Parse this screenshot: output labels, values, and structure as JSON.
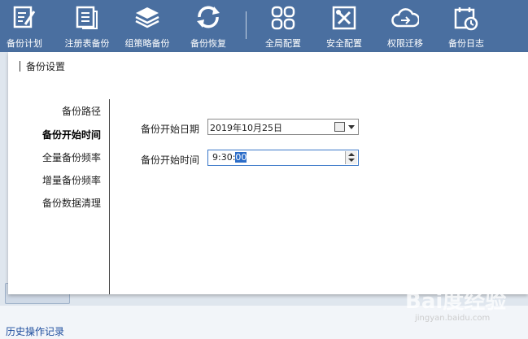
{
  "toolbar": {
    "items": [
      {
        "label": "备份计划",
        "icon": "edit-list-icon"
      },
      {
        "label": "注册表备份",
        "icon": "document-list-icon"
      },
      {
        "label": "组策略备份",
        "icon": "layers-icon"
      },
      {
        "label": "备份恢复",
        "icon": "refresh-icon"
      },
      {
        "label": "全局配置",
        "icon": "grid-icon"
      },
      {
        "label": "安全配置",
        "icon": "tools-icon"
      },
      {
        "label": "权限迁移",
        "icon": "cloud-transfer-icon"
      },
      {
        "label": "备份日志",
        "icon": "calendar-clock-icon"
      }
    ]
  },
  "panel": {
    "title": "备份设置",
    "nav": [
      {
        "label": "备份路径",
        "active": false
      },
      {
        "label": "备份开始时间",
        "active": true
      },
      {
        "label": "全量备份频率",
        "active": false
      },
      {
        "label": "增量备份频率",
        "active": false
      },
      {
        "label": "备份数据清理",
        "active": false
      }
    ],
    "form": {
      "date_label": "备份开始日期",
      "date_value": "2019年10月25日",
      "time_label": "备份开始时间",
      "time_value_prefix": "9:30:",
      "time_value_selected": "00"
    }
  },
  "bottom": {
    "history_link": "历史操作记录"
  },
  "watermark": {
    "main": "Bai度经验",
    "sub": "jingyan.baidu.com"
  },
  "colors": {
    "toolbar_bg": "#4a6fa0",
    "selection": "#2a6cc8"
  }
}
